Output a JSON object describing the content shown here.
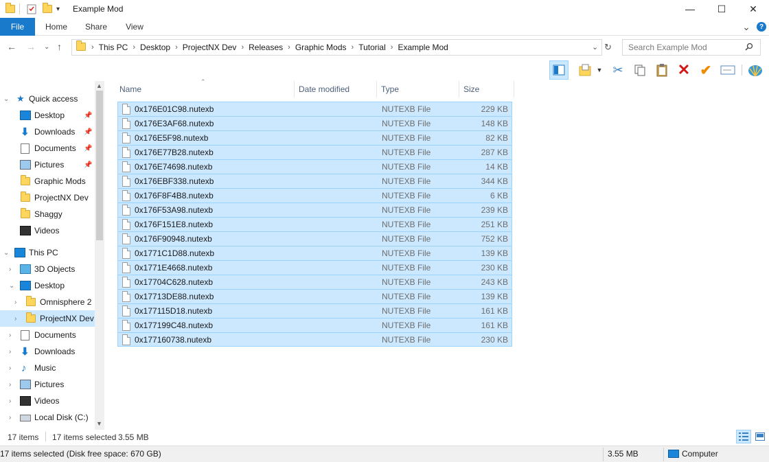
{
  "window": {
    "title": "Example Mod",
    "minimize": "—",
    "maximize": "☐",
    "close": "✕"
  },
  "ribbon": {
    "tabs": [
      "File",
      "Home",
      "Share",
      "View"
    ],
    "collapse": "⌄",
    "help": "?"
  },
  "address": {
    "crumbs": [
      "This PC",
      "Desktop",
      "ProjectNX Dev",
      "Releases",
      "Graphic Mods",
      "Tutorial",
      "Example Mod"
    ],
    "search_placeholder": "Search Example Mod"
  },
  "nav_pane": {
    "quick_access": {
      "label": "Quick access",
      "items": [
        {
          "label": "Desktop",
          "icon": "desktop-icon",
          "pinned": true
        },
        {
          "label": "Downloads",
          "icon": "downloads-icon",
          "pinned": true
        },
        {
          "label": "Documents",
          "icon": "documents-icon",
          "pinned": true
        },
        {
          "label": "Pictures",
          "icon": "pictures-icon",
          "pinned": true
        },
        {
          "label": "Graphic Mods",
          "icon": "folder-icon",
          "pinned": false
        },
        {
          "label": "ProjectNX Dev",
          "icon": "folder-icon",
          "pinned": false
        },
        {
          "label": "Shaggy",
          "icon": "folder-icon",
          "pinned": false
        },
        {
          "label": "Videos",
          "icon": "videos-icon",
          "pinned": false
        }
      ]
    },
    "this_pc": {
      "label": "This PC",
      "items": [
        {
          "label": "3D Objects",
          "icon": "3d-objects-icon"
        },
        {
          "label": "Desktop",
          "icon": "desktop-icon"
        },
        {
          "label": "Omnisphere 2",
          "icon": "folder-icon"
        },
        {
          "label": "ProjectNX Dev",
          "icon": "folder-icon"
        },
        {
          "label": "Documents",
          "icon": "documents-icon"
        },
        {
          "label": "Downloads",
          "icon": "downloads-icon"
        },
        {
          "label": "Music",
          "icon": "music-icon"
        },
        {
          "label": "Pictures",
          "icon": "pictures-icon"
        },
        {
          "label": "Videos",
          "icon": "videos-icon"
        },
        {
          "label": "Local Disk (C:)",
          "icon": "local-disk-icon"
        }
      ]
    }
  },
  "columns": {
    "name": "Name",
    "date_modified": "Date modified",
    "type": "Type",
    "size": "Size"
  },
  "files": [
    {
      "name": "0x176E01C98.nutexb",
      "type": "NUTEXB File",
      "size": "229 KB"
    },
    {
      "name": "0x176E3AF68.nutexb",
      "type": "NUTEXB File",
      "size": "148 KB"
    },
    {
      "name": "0x176E5F98.nutexb",
      "type": "NUTEXB File",
      "size": "82 KB"
    },
    {
      "name": "0x176E77B28.nutexb",
      "type": "NUTEXB File",
      "size": "287 KB"
    },
    {
      "name": "0x176E74698.nutexb",
      "type": "NUTEXB File",
      "size": "14 KB"
    },
    {
      "name": "0x176EBF338.nutexb",
      "type": "NUTEXB File",
      "size": "344 KB"
    },
    {
      "name": "0x176F8F4B8.nutexb",
      "type": "NUTEXB File",
      "size": "6 KB"
    },
    {
      "name": "0x176F53A98.nutexb",
      "type": "NUTEXB File",
      "size": "239 KB"
    },
    {
      "name": "0x176F151E8.nutexb",
      "type": "NUTEXB File",
      "size": "251 KB"
    },
    {
      "name": "0x176F90948.nutexb",
      "type": "NUTEXB File",
      "size": "752 KB"
    },
    {
      "name": "0x1771C1D88.nutexb",
      "type": "NUTEXB File",
      "size": "139 KB"
    },
    {
      "name": "0x1771E4668.nutexb",
      "type": "NUTEXB File",
      "size": "230 KB"
    },
    {
      "name": "0x17704C628.nutexb",
      "type": "NUTEXB File",
      "size": "243 KB"
    },
    {
      "name": "0x17713DE88.nutexb",
      "type": "NUTEXB File",
      "size": "139 KB"
    },
    {
      "name": "0x177115D18.nutexb",
      "type": "NUTEXB File",
      "size": "161 KB"
    },
    {
      "name": "0x177199C48.nutexb",
      "type": "NUTEXB File",
      "size": "161 KB"
    },
    {
      "name": "0x177160738.nutexb",
      "type": "NUTEXB File",
      "size": "230 KB"
    }
  ],
  "status": {
    "item_count": "17 items",
    "selected": "17 items selected",
    "selected_size": "3.55 MB",
    "details": "17 items selected (Disk free space: 670 GB)",
    "details_size": "3.55 MB",
    "location": "Computer"
  },
  "colors": {
    "accent": "#1979ca",
    "selection_fill": "#cce8ff",
    "selection_border": "#99d1ff",
    "folder": "#ffd65c"
  }
}
